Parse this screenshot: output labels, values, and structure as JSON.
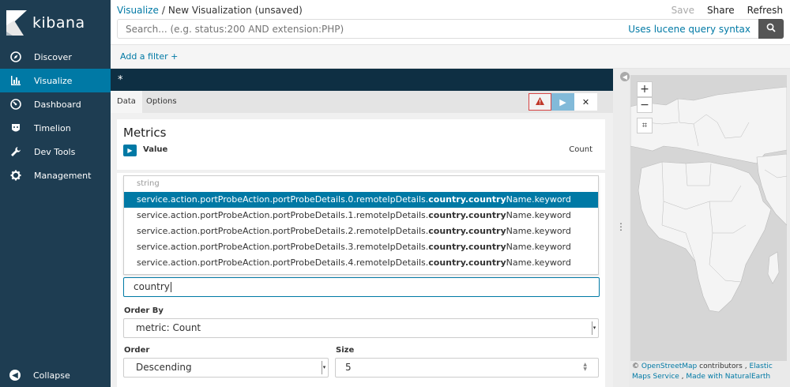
{
  "app": {
    "brand": "kibana"
  },
  "nav": {
    "items": [
      {
        "label": "Discover",
        "icon": "compass-icon"
      },
      {
        "label": "Visualize",
        "icon": "bar-chart-icon",
        "active": true
      },
      {
        "label": "Dashboard",
        "icon": "dashboard-icon"
      },
      {
        "label": "Timelion",
        "icon": "timelion-icon"
      },
      {
        "label": "Dev Tools",
        "icon": "wrench-icon"
      },
      {
        "label": "Management",
        "icon": "gear-icon"
      }
    ],
    "collapse_label": "Collapse"
  },
  "breadcrumb": {
    "root": "Visualize",
    "separator": "/",
    "current": "New Visualization (unsaved)"
  },
  "top_actions": {
    "save": "Save",
    "share": "Share",
    "refresh": "Refresh"
  },
  "search": {
    "placeholder": "Search... (e.g. status:200 AND extension:PHP)",
    "syntax_link": "Uses lucene query syntax"
  },
  "filter": {
    "add_label": "Add a filter +"
  },
  "editor": {
    "title": "*",
    "tabs": [
      "Data",
      "Options"
    ],
    "active_tab": "Data"
  },
  "metrics": {
    "heading": "Metrics",
    "item_label": "Value",
    "item_agg": "Count"
  },
  "field_dropdown": {
    "group": "string",
    "items": [
      {
        "prefix": "service.action.portProbeAction.portProbeDetails.0.remoteIpDetails.",
        "match": "country.country",
        "suffix": "Name.keyword",
        "selected": true
      },
      {
        "prefix": "service.action.portProbeAction.portProbeDetails.1.remoteIpDetails.",
        "match": "country.country",
        "suffix": "Name.keyword"
      },
      {
        "prefix": "service.action.portProbeAction.portProbeDetails.2.remoteIpDetails.",
        "match": "country.country",
        "suffix": "Name.keyword"
      },
      {
        "prefix": "service.action.portProbeAction.portProbeDetails.3.remoteIpDetails.",
        "match": "country.country",
        "suffix": "Name.keyword"
      },
      {
        "prefix": "service.action.portProbeAction.portProbeDetails.4.remoteIpDetails.",
        "match": "country.country",
        "suffix": "Name.keyword"
      }
    ]
  },
  "field_input": {
    "value": "country"
  },
  "order_by": {
    "label": "Order By",
    "value": "metric: Count"
  },
  "order": {
    "label": "Order",
    "value": "Descending"
  },
  "size": {
    "label": "Size",
    "value": "5"
  },
  "map": {
    "zoom_in": "+",
    "zoom_out": "−",
    "attribution_prefix": "©",
    "osm": "OpenStreetMap",
    "contributors": " contributors , ",
    "elastic": "Elastic Maps Service",
    "sep": " , ",
    "natural_earth": "Made with NaturalEarth"
  },
  "colors": {
    "sidebar": "#1e3d52",
    "accent": "#0079a5",
    "titlebar": "#0e2f43"
  }
}
